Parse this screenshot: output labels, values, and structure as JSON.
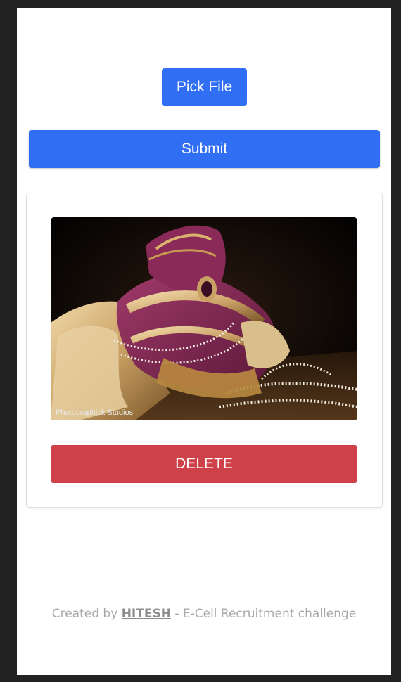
{
  "actions": {
    "pick_file_label": "Pick File",
    "submit_label": "Submit"
  },
  "card": {
    "image_caption": "Photographick Studios",
    "delete_label": "DELETE"
  },
  "footer": {
    "prefix": "Created by",
    "author": "HITESH",
    "suffix": "- E-Cell Recruitment challenge"
  },
  "colors": {
    "primary": "#306ef4",
    "danger": "#cf4149",
    "footer_text": "#a8a8a8",
    "background": "#222222"
  }
}
